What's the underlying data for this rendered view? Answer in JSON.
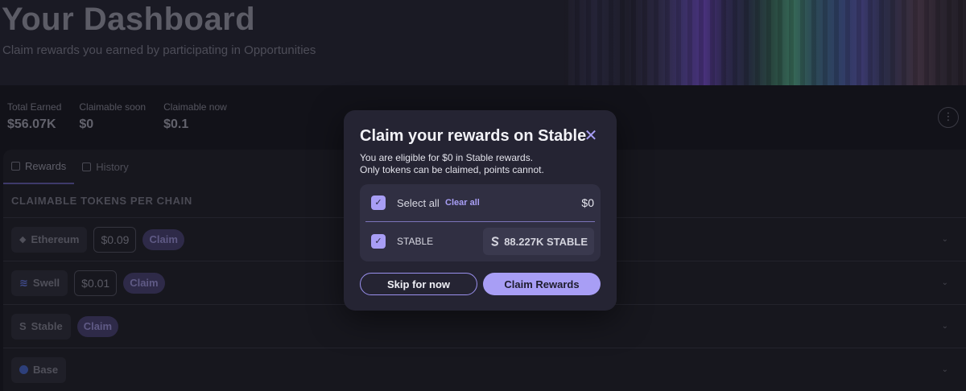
{
  "header": {
    "title": "Your Dashboard",
    "subtitle": "Claim rewards you earned by participating in Opportunities"
  },
  "stats": [
    {
      "label": "Total Earned",
      "value": "$56.07K"
    },
    {
      "label": "Claimable soon",
      "value": "$0"
    },
    {
      "label": "Claimable now",
      "value": "$0.1"
    }
  ],
  "tabs": [
    {
      "label": "Rewards",
      "icon": "gift-icon",
      "active": true
    },
    {
      "label": "History",
      "icon": "history-icon",
      "active": false
    }
  ],
  "section_title": "CLAIMABLE TOKENS PER CHAIN",
  "chains": [
    {
      "name": "Ethereum",
      "amount": "$0.09",
      "claim_label": "Claim"
    },
    {
      "name": "Swell",
      "amount": "$0.01",
      "claim_label": "Claim"
    },
    {
      "name": "Stable",
      "amount": "",
      "claim_label": "Claim"
    },
    {
      "name": "Base",
      "amount": "",
      "claim_label": ""
    }
  ],
  "modal": {
    "title": "Claim your rewards on Stable",
    "desc_line1": "You are eligible for $0 in Stable rewards.",
    "desc_line2": "Only tokens can be claimed, points cannot.",
    "select_all_label": "Select all",
    "clear_all_label": "Clear all",
    "select_all_amount": "$0",
    "token_label": "STABLE",
    "token_amount": "88.227K STABLE",
    "skip_label": "Skip for now",
    "claim_label": "Claim Rewards"
  },
  "colors": {
    "accent": "#a89ef5",
    "modal_bg": "#252433",
    "page_bg": "#121219"
  }
}
